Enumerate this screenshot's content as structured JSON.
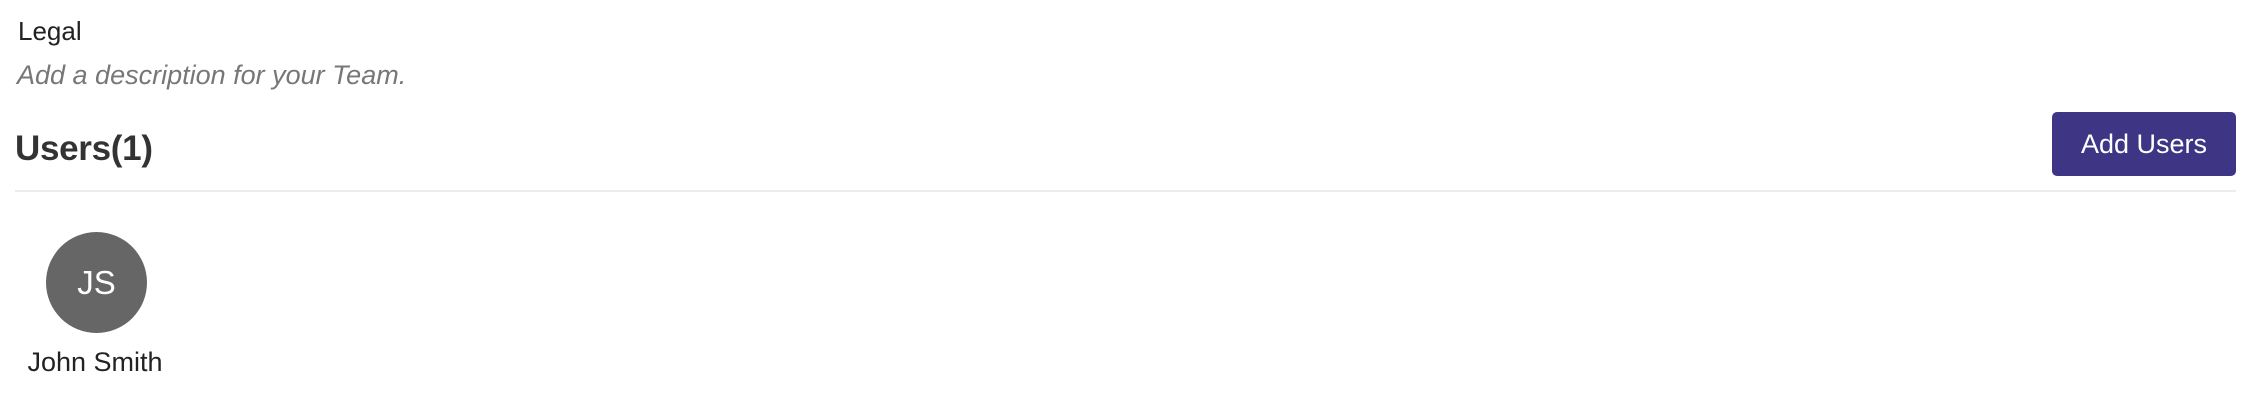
{
  "team": {
    "name": "Legal",
    "description_placeholder": "Add a description for your Team."
  },
  "users_section": {
    "title": "Users(1)",
    "add_button_label": "Add Users",
    "users": [
      {
        "initials": "JS",
        "name": "John Smith"
      }
    ]
  },
  "colors": {
    "primary_button": "#3e3585",
    "avatar_background": "#666666",
    "placeholder_text": "#777777"
  }
}
